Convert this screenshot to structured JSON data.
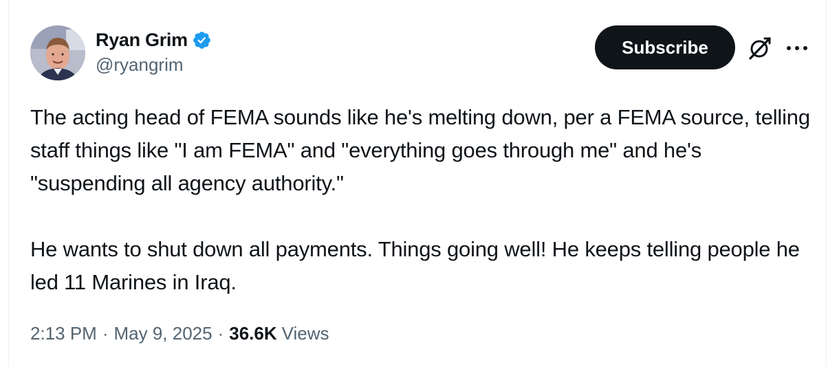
{
  "author": {
    "display_name": "Ryan Grim",
    "handle": "@ryangrim",
    "verified": true,
    "avatar_icon": "avatar-photo"
  },
  "actions": {
    "subscribe_label": "Subscribe",
    "grok_icon": "grok-icon",
    "more_icon": "more-icon"
  },
  "tweet": {
    "paragraphs": [
      "The acting head of FEMA sounds like he's melting down, per a FEMA source, telling staff things like \"I am FEMA\" and \"everything goes through me\" and he's \"suspending all agency authority.\"",
      "He wants to shut down all payments. Things going well! He keeps telling people he led 11 Marines in Iraq."
    ]
  },
  "meta": {
    "time": "2:13 PM",
    "separator": "·",
    "date": "May 9, 2025",
    "views_count": "36.6K",
    "views_label": "Views"
  },
  "colors": {
    "text_primary": "#0f1419",
    "text_secondary": "#536471",
    "verified_blue": "#1d9bf0",
    "button_bg": "#0f1419"
  }
}
